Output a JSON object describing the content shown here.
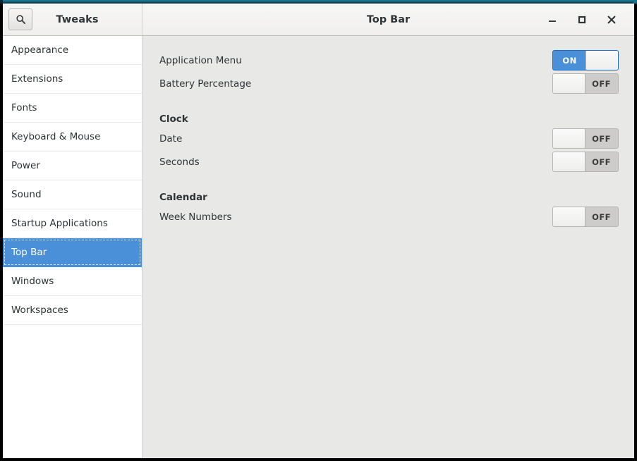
{
  "window": {
    "app_title": "Tweaks",
    "page_title": "Top Bar",
    "accent_color": "#4a90d9",
    "titlebar_accent": "#0f5a6e",
    "controls": {
      "minimize": "minimize",
      "maximize": "maximize",
      "close": "close"
    },
    "search_icon": "search-icon"
  },
  "sidebar": {
    "items": [
      {
        "label": "Appearance",
        "selected": false
      },
      {
        "label": "Extensions",
        "selected": false
      },
      {
        "label": "Fonts",
        "selected": false
      },
      {
        "label": "Keyboard & Mouse",
        "selected": false
      },
      {
        "label": "Power",
        "selected": false
      },
      {
        "label": "Sound",
        "selected": false
      },
      {
        "label": "Startup Applications",
        "selected": false
      },
      {
        "label": "Top Bar",
        "selected": true
      },
      {
        "label": "Windows",
        "selected": false
      },
      {
        "label": "Workspaces",
        "selected": false
      }
    ]
  },
  "content": {
    "rows": [
      {
        "type": "setting",
        "label": "Application Menu",
        "state": "ON"
      },
      {
        "type": "setting",
        "label": "Battery Percentage",
        "state": "OFF"
      },
      {
        "type": "section",
        "label": "Clock"
      },
      {
        "type": "setting",
        "label": "Date",
        "state": "OFF"
      },
      {
        "type": "setting",
        "label": "Seconds",
        "state": "OFF"
      },
      {
        "type": "section",
        "label": "Calendar"
      },
      {
        "type": "setting",
        "label": "Week Numbers",
        "state": "OFF"
      }
    ]
  }
}
